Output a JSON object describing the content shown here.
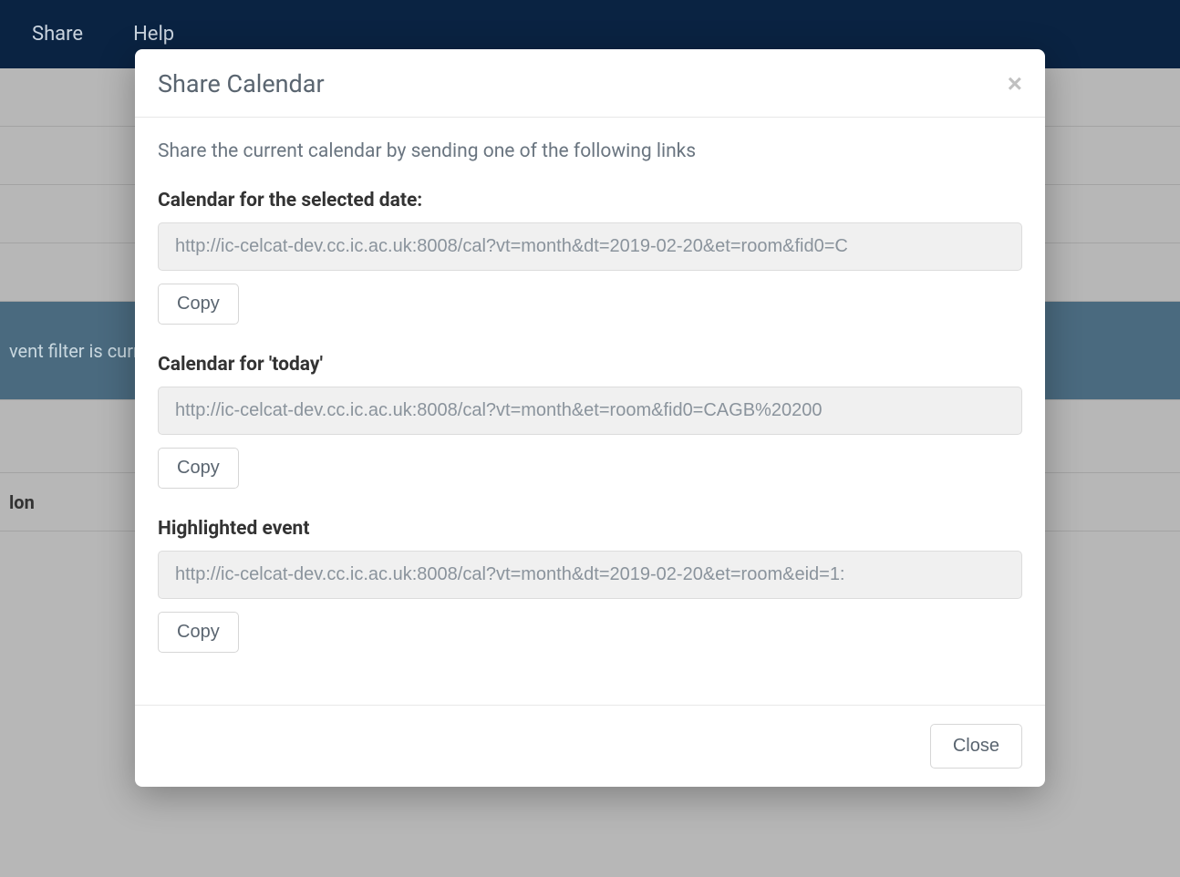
{
  "navbar": {
    "share": "Share",
    "help": "Help"
  },
  "background": {
    "filter_text": "vent filter is currently",
    "col_header": "lon"
  },
  "modal": {
    "title": "Share Calendar",
    "intro": "Share the current calendar by sending one of the following links",
    "sections": [
      {
        "label": "Calendar for the selected date:",
        "url": "http://ic-celcat-dev.cc.ic.ac.uk:8008/cal?vt=month&dt=2019-02-20&et=room&fid0=C",
        "copy": "Copy"
      },
      {
        "label": "Calendar for 'today'",
        "url": "http://ic-celcat-dev.cc.ic.ac.uk:8008/cal?vt=month&et=room&fid0=CAGB%20200",
        "copy": "Copy"
      },
      {
        "label": "Highlighted event",
        "url": "http://ic-celcat-dev.cc.ic.ac.uk:8008/cal?vt=month&dt=2019-02-20&et=room&eid=1:",
        "copy": "Copy"
      }
    ],
    "close": "Close"
  }
}
